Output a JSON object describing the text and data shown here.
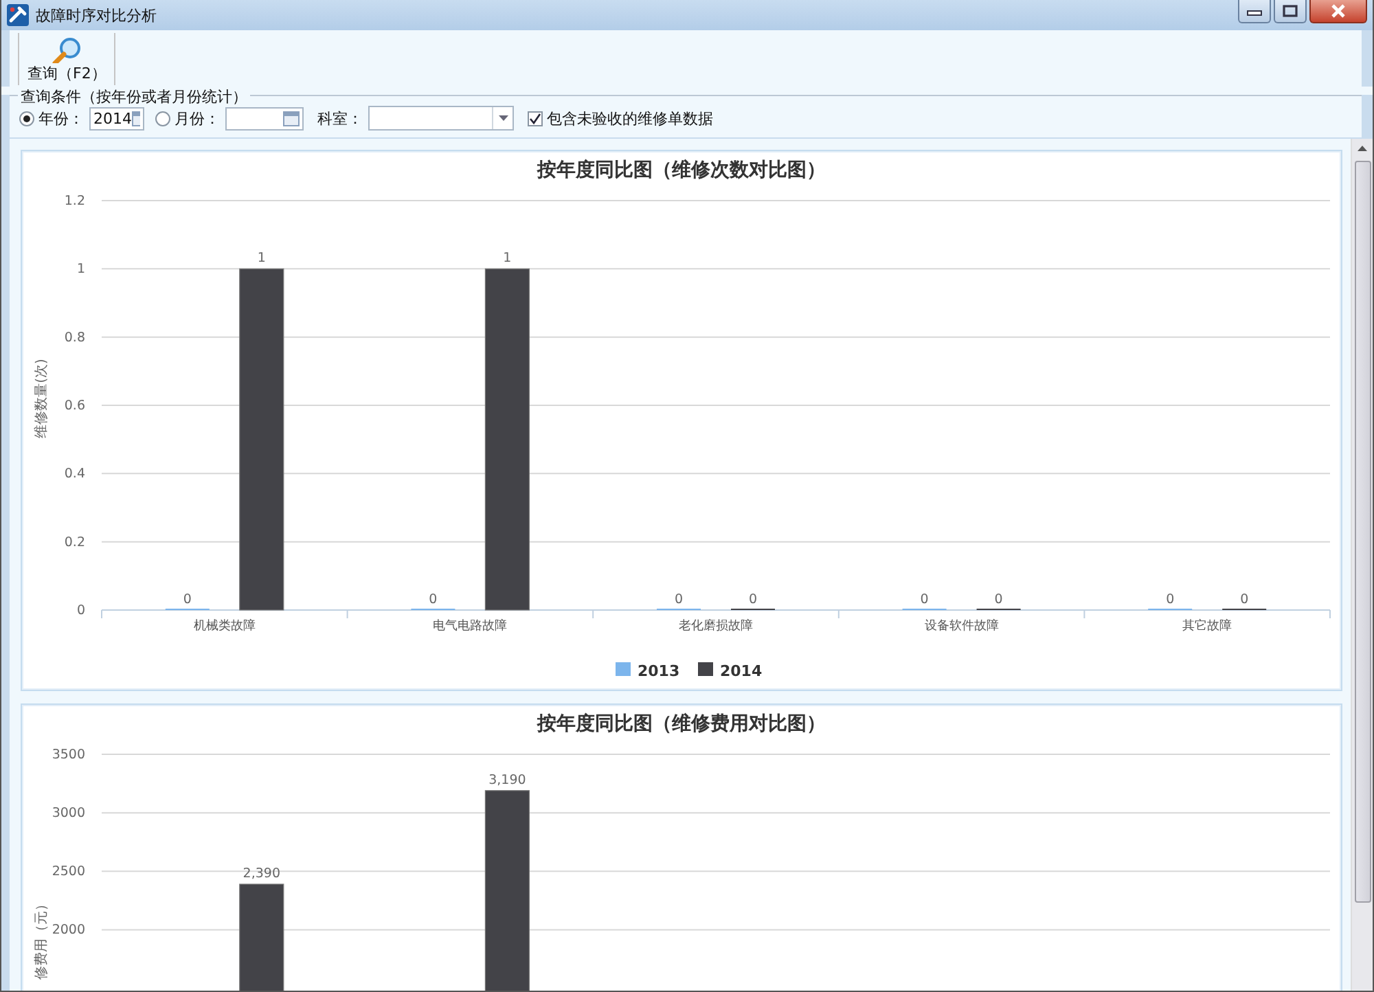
{
  "window": {
    "title": "故障时序对比分析"
  },
  "toolbar": {
    "buttons": [
      {
        "label": "查询（F2）"
      }
    ]
  },
  "query": {
    "legend": "查询条件（按年份或者月份统计）",
    "mode": [
      {
        "label": "年份：",
        "selected": true
      },
      {
        "label": "月份：",
        "selected": false
      }
    ],
    "year": {
      "value": "2014"
    },
    "department": {
      "label": "科室："
    },
    "include_unaccepted": {
      "label": "包含未验收的维修单数据",
      "checked": true
    }
  },
  "charts": [
    {
      "chart_data": {
        "type": "bar",
        "title": "按年度同比图（维修次数对比图）",
        "ylabel": "维修数量(次)",
        "categories": [
          "机械类故障",
          "电气电路故障",
          "老化磨损故障",
          "设备软件故障",
          "其它故障"
        ],
        "series": [
          {
            "name": "2013",
            "color": "#7cb5ec",
            "values": [
              0,
              0,
              0,
              0,
              0
            ]
          },
          {
            "name": "2014",
            "color": "#434348",
            "values": [
              1,
              1,
              0,
              0,
              0
            ]
          }
        ],
        "ylim": [
          0,
          1.2
        ],
        "yticks": [
          0,
          0.2,
          0.4,
          0.6,
          0.8,
          1,
          1.2
        ],
        "grid": true,
        "legend": "bottom",
        "data_labels": true
      }
    },
    {
      "chart_data": {
        "type": "bar",
        "title": "按年度同比图（维修费用对比图）",
        "ylabel": "修费用（元）",
        "series": [
          {
            "color": "#434348",
            "values": [
              2390,
              3190,
              null,
              null,
              null
            ]
          }
        ],
        "ylim": [
          0,
          3500
        ],
        "yticks": [
          2000,
          2500,
          3000,
          3500
        ],
        "grid": true,
        "value_labels": [
          [
            "2,390",
            "3,190",
            null,
            null,
            null
          ]
        ]
      }
    }
  ]
}
